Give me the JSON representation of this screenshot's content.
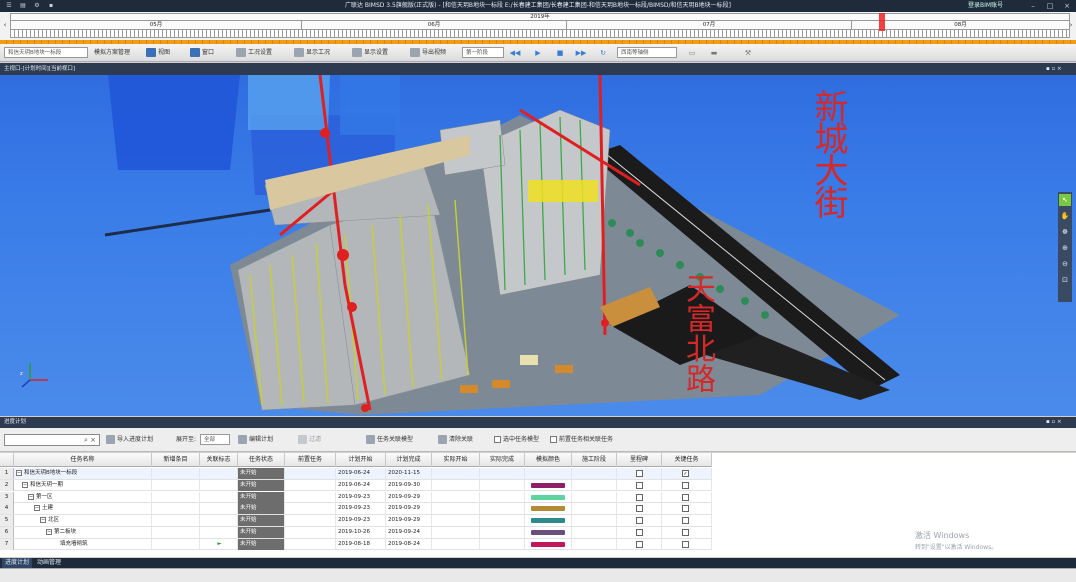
{
  "window": {
    "title": "广联达 BIMSD 3.5旗舰版(正式版) - [和信天玥B地块一标段 E:/长春建工集团/长春建工集团-和信天玥B地块一标段/BIMSD/和信天玥B地块一标段]",
    "right_text": "登录BIM账号"
  },
  "timeline": {
    "year": "2019年",
    "months": [
      "05月",
      "06月",
      "07月",
      "08月"
    ],
    "marker_fraction": 0.82
  },
  "toolbar": {
    "project_combo": "和信天玥B地块一标段",
    "schedule_mgmt": "模拟方案管理",
    "view": "视图",
    "window": "窗口",
    "work_settings": "工况设置",
    "show_work": "显示工况",
    "display_settings": "显示设置",
    "export_video": "导出视频",
    "speed_combo": "第一阶段",
    "camera_combo": "西南等轴侧"
  },
  "view": {
    "header": "主视口-[计划时间][当前视口]",
    "road_labels": {
      "street_vertical": "新城大街",
      "road_vertical": "天富北路"
    }
  },
  "panel": {
    "header": "进度计划",
    "search_placeholder": "",
    "import_plan": "导入进度计划",
    "expand_to": "展开至:",
    "expand_value": "全部",
    "edit_plan": "编辑计划",
    "filter": "过滤",
    "task_link_model": "任务关联模型",
    "clear_link": "清除关联",
    "select_task_model": "选中任务模型",
    "auto_link_next": "前置任务相关联任务"
  },
  "grid": {
    "columns": [
      "",
      "任务名称",
      "新增条目",
      "关联标志",
      "任务状态",
      "前置任务",
      "计划开始",
      "计划完成",
      "实际开始",
      "实际完成",
      "模拟颜色",
      "施工阶段",
      "里程碑",
      "关键任务"
    ],
    "rows": [
      {
        "n": "1",
        "name": "和信天玥B地块一标段",
        "level": 0,
        "flag": "",
        "status": "未开始",
        "start": "2019-06-24",
        "end": "2020-11-15",
        "color": "",
        "milestone": false,
        "key": true
      },
      {
        "n": "2",
        "name": "和信天玥一期",
        "level": 1,
        "flag": "",
        "status": "未开始",
        "start": "2019-06-24",
        "end": "2019-09-30",
        "color": "#8e1f66",
        "milestone": false,
        "key": false
      },
      {
        "n": "3",
        "name": "第一区",
        "level": 2,
        "flag": "",
        "status": "未开始",
        "start": "2019-09-23",
        "end": "2019-09-29",
        "color": "#5dd39e",
        "milestone": false,
        "key": false
      },
      {
        "n": "4",
        "name": "土建",
        "level": 3,
        "flag": "",
        "status": "未开始",
        "start": "2019-09-23",
        "end": "2019-09-29",
        "color": "#b48a35",
        "milestone": false,
        "key": false
      },
      {
        "n": "5",
        "name": "北区",
        "level": 4,
        "flag": "",
        "status": "未开始",
        "start": "2019-09-23",
        "end": "2019-09-29",
        "color": "#2e8b8b",
        "milestone": false,
        "key": false
      },
      {
        "n": "6",
        "name": "第二板块",
        "level": 5,
        "flag": "",
        "status": "未开始",
        "start": "2019-10-26",
        "end": "2019-09-24",
        "color": "#6a4e7c",
        "milestone": false,
        "key": false
      },
      {
        "n": "7",
        "name": "填充墙砌筑",
        "level": 6,
        "flag": "►",
        "status": "未开始",
        "start": "2019-08-18",
        "end": "2019-08-24",
        "color": "#c2185b",
        "milestone": false,
        "key": false
      }
    ]
  },
  "tabs": [
    "进度计划",
    "动画管理"
  ],
  "watermark": {
    "line1": "激活 Windows",
    "line2": "转到\"设置\"以激活 Windows。"
  },
  "colors": {
    "sky": "#3a7de8",
    "crane": "#e02020",
    "road_text": "#d62828",
    "status_bg": "#6d6d6d"
  }
}
